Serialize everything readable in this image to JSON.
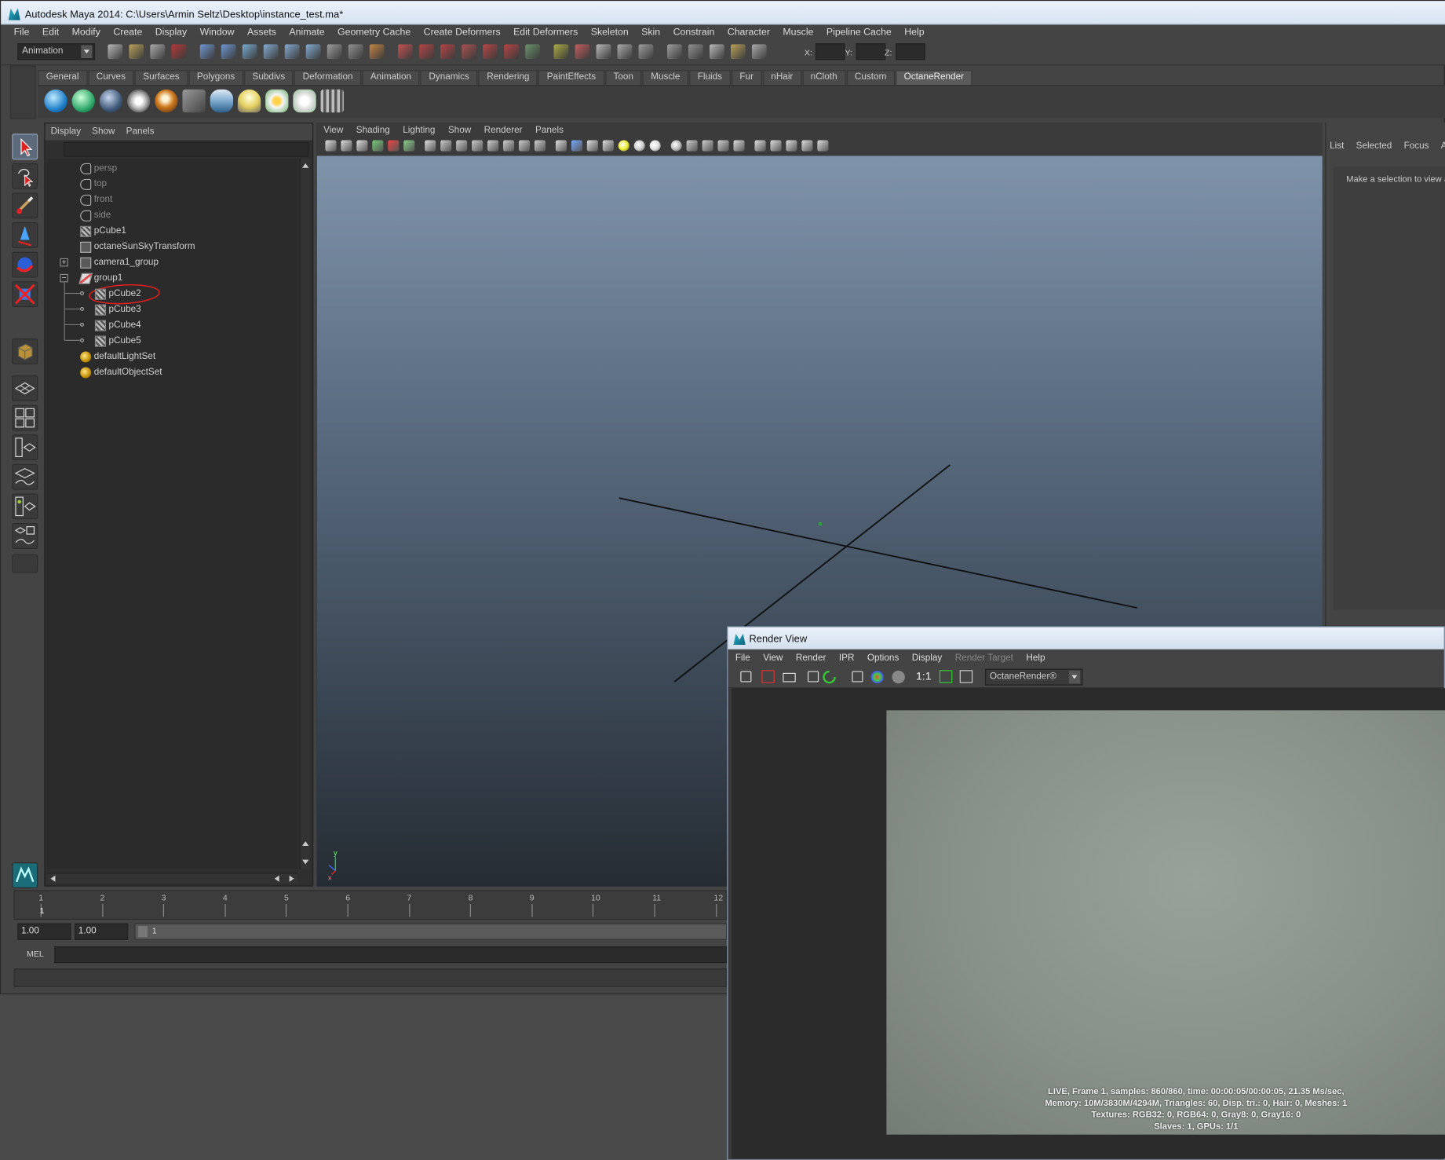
{
  "app": {
    "title": "Autodesk Maya 2014: C:\\Users\\Armin Seltz\\Desktop\\instance_test.ma*"
  },
  "menubar": [
    "File",
    "Edit",
    "Modify",
    "Create",
    "Display",
    "Window",
    "Assets",
    "Animate",
    "Geometry Cache",
    "Create Deformers",
    "Edit Deformers",
    "Skeleton",
    "Skin",
    "Constrain",
    "Character",
    "Muscle",
    "Pipeline Cache",
    "Help"
  ],
  "statusline": {
    "menu_set": "Animation",
    "x_label": "X:",
    "y_label": "Y:",
    "z_label": "Z:"
  },
  "shelf": {
    "tabs": [
      "General",
      "Curves",
      "Surfaces",
      "Polygons",
      "Subdivs",
      "Deformation",
      "Animation",
      "Dynamics",
      "Rendering",
      "PaintEffects",
      "Toon",
      "Muscle",
      "Fluids",
      "Fur",
      "nHair",
      "nCloth",
      "Custom",
      "OctaneRender"
    ],
    "active_tab": "OctaneRender",
    "icons": [
      "octane-sphere-blue-icon",
      "octane-sphere-green-icon",
      "octane-sphere-dark-icon",
      "octane-gear-sphere-icon",
      "octane-box-icon",
      "octane-camera-icon",
      "octane-layers-icon",
      "octane-lightbulb-icon",
      "octane-flower-icon",
      "octane-flower-white-icon",
      "octane-grid-icon"
    ]
  },
  "outliner": {
    "menu": [
      "Display",
      "Show",
      "Panels"
    ],
    "items": [
      {
        "label": "persp",
        "icon": "camera-icon",
        "dim": true
      },
      {
        "label": "top",
        "icon": "camera-icon",
        "dim": true
      },
      {
        "label": "front",
        "icon": "camera-icon",
        "dim": true
      },
      {
        "label": "side",
        "icon": "camera-icon",
        "dim": true
      },
      {
        "label": "pCube1",
        "icon": "mesh-icon",
        "dim": false
      },
      {
        "label": "octaneSunSkyTransform",
        "icon": "transform-icon",
        "dim": false
      },
      {
        "label": "camera1_group",
        "icon": "transform-icon",
        "dim": false
      },
      {
        "label": "group1",
        "icon": "group-icon",
        "dim": false
      },
      {
        "label": "pCube2",
        "icon": "mesh-icon",
        "dim": false
      },
      {
        "label": "pCube3",
        "icon": "mesh-icon",
        "dim": false
      },
      {
        "label": "pCube4",
        "icon": "mesh-icon",
        "dim": false
      },
      {
        "label": "pCube5",
        "icon": "mesh-icon",
        "dim": false
      },
      {
        "label": "defaultLightSet",
        "icon": "set-icon",
        "dim": false
      },
      {
        "label": "defaultObjectSet",
        "icon": "set-icon",
        "dim": false
      }
    ]
  },
  "viewport": {
    "menu": [
      "View",
      "Shading",
      "Lighting",
      "Show",
      "Renderer",
      "Panels"
    ],
    "axis_x": "x",
    "axis_y": "y"
  },
  "attribute_panel": {
    "menu": [
      "List",
      "Selected",
      "Focus",
      "At"
    ],
    "message": "Make a selection to view a"
  },
  "timeline": {
    "ticks": [
      "1",
      "2",
      "3",
      "4",
      "5",
      "6",
      "7",
      "8",
      "9",
      "10",
      "11",
      "12"
    ],
    "current_frame": "1"
  },
  "range": {
    "start": "1.00",
    "end": "1.00",
    "slider_value": "1"
  },
  "cmdline": {
    "label": "MEL"
  },
  "render_view": {
    "title": "Render View",
    "menu": [
      {
        "label": "File",
        "disabled": false
      },
      {
        "label": "View",
        "disabled": false
      },
      {
        "label": "Render",
        "disabled": false
      },
      {
        "label": "IPR",
        "disabled": false
      },
      {
        "label": "Options",
        "disabled": false
      },
      {
        "label": "Display",
        "disabled": false
      },
      {
        "label": "Render Target",
        "disabled": true
      },
      {
        "label": "Help",
        "disabled": false
      }
    ],
    "ratio_label": "1:1",
    "renderer": "OctaneRender®",
    "status": [
      "LIVE, Frame 1, samples: 860/860, time: 00:00:05/00:00:05, 21.35 Ms/sec,",
      "Memory: 10M/3830M/4294M, Triangles: 60, Disp. tri.: 0, Hair: 0, Meshes: 1",
      "Textures: RGB32: 0, RGB64: 0, Gray8: 0, Gray16: 0",
      "Slaves: 1, GPUs: 1/1"
    ]
  }
}
